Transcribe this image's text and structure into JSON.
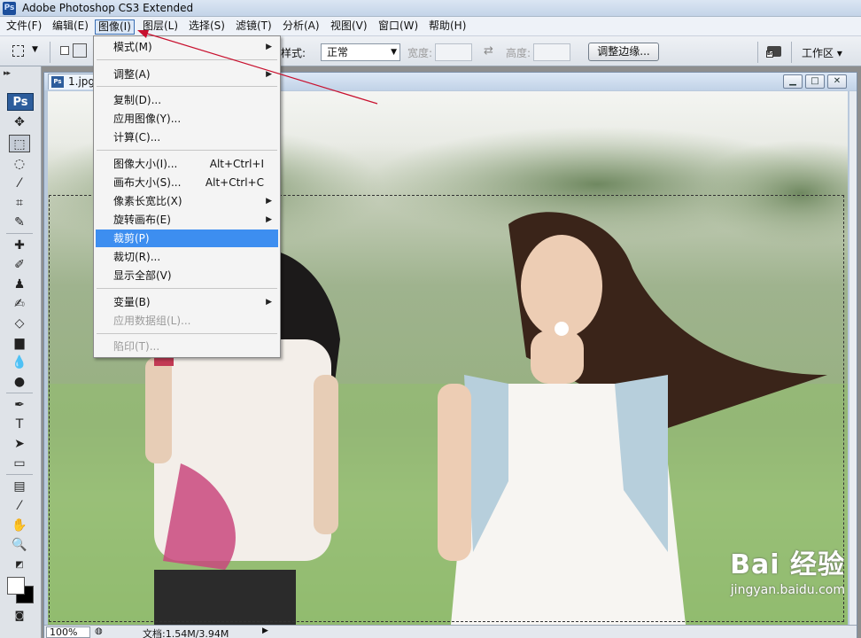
{
  "window": {
    "title": "Adobe Photoshop CS3 Extended",
    "logo": "Ps"
  },
  "menubar": {
    "items": [
      "文件(F)",
      "编辑(E)",
      "图像(I)",
      "图层(L)",
      "选择(S)",
      "滤镜(T)",
      "分析(A)",
      "视图(V)",
      "窗口(W)",
      "帮助(H)"
    ],
    "active_item": "图像(I)"
  },
  "options": {
    "style_label": "样式:",
    "style_value": "正常",
    "width_label": "宽度:",
    "height_label": "高度:",
    "refine_edge": "调整边缘...",
    "workspace": "工作区 ▾"
  },
  "tools": {
    "badge": "Ps"
  },
  "document": {
    "tab_title": "1.jpg",
    "tab_icon": "Ps",
    "zoom": "100%",
    "doc_info": "文档:1.54M/3.94M"
  },
  "image_menu": {
    "items": [
      {
        "label": "模式(M)",
        "submenu": true
      },
      {
        "label": "调整(A)",
        "submenu": true
      },
      {
        "label": "复制(D)..."
      },
      {
        "label": "应用图像(Y)..."
      },
      {
        "label": "计算(C)..."
      },
      {
        "label": "图像大小(I)...",
        "shortcut": "Alt+Ctrl+I"
      },
      {
        "label": "画布大小(S)...",
        "shortcut": "Alt+Ctrl+C"
      },
      {
        "label": "像素长宽比(X)",
        "submenu": true
      },
      {
        "label": "旋转画布(E)",
        "submenu": true
      },
      {
        "label": "裁剪(P)",
        "highlighted": true
      },
      {
        "label": "裁切(R)..."
      },
      {
        "label": "显示全部(V)"
      },
      {
        "label": "变量(B)",
        "submenu": true
      },
      {
        "label": "应用数据组(L)...",
        "disabled": true
      },
      {
        "label": "陷印(T)...",
        "disabled": true
      }
    ]
  },
  "watermark": {
    "brand": "Bai 经验",
    "site": "jingyan.baidu.com"
  },
  "colors": {
    "highlight": "#3d8ef0",
    "annotation": "#c8102e",
    "canvas_grass": "#8fba6d"
  }
}
